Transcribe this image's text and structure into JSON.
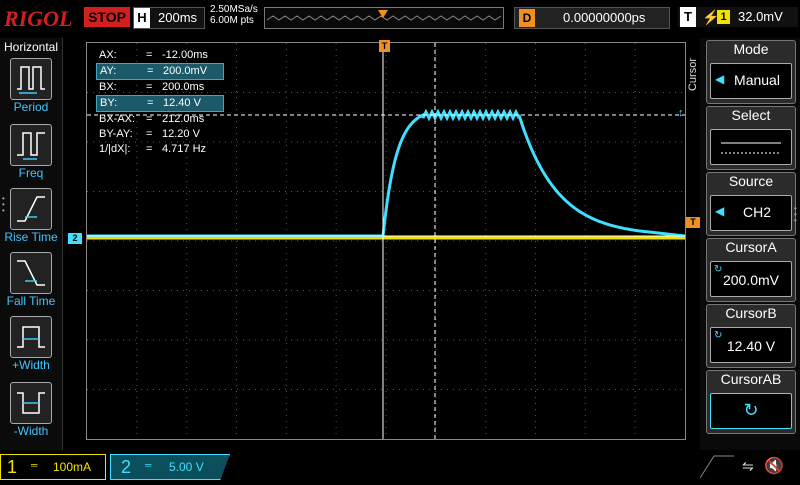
{
  "topbar": {
    "brand": "RIGOL",
    "run_state": "STOP",
    "timebase_tag": "H",
    "timebase": "200ms",
    "sample_rate": "2.50MSa/s",
    "memory_depth": "6.00M pts",
    "delay_tag": "D",
    "delay": "0.00000000ps",
    "trigger_tag": "T",
    "trigger_channel": "1",
    "trigger_level": "32.0mV"
  },
  "left_panel": {
    "title": "Horizontal",
    "buttons": [
      {
        "label": "Period",
        "icon": "period-icon"
      },
      {
        "label": "Freq",
        "icon": "freq-icon"
      },
      {
        "label": "Rise Time",
        "icon": "rise-time-icon"
      },
      {
        "label": "Fall Time",
        "icon": "fall-time-icon"
      },
      {
        "label": "+Width",
        "icon": "pos-width-icon"
      },
      {
        "label": "-Width",
        "icon": "neg-width-icon"
      }
    ]
  },
  "cursor_table": [
    {
      "key": "AX:",
      "value": "-12.00ms",
      "highlight": false
    },
    {
      "key": "AY:",
      "value": "200.0mV",
      "highlight": true
    },
    {
      "key": "BX:",
      "value": "200.0ms",
      "highlight": false
    },
    {
      "key": "BY:",
      "value": "12.40 V",
      "highlight": true
    },
    {
      "key": "BX-AX:",
      "value": "212.0ms",
      "highlight": false
    },
    {
      "key": "BY-AY:",
      "value": "12.20 V",
      "highlight": false
    },
    {
      "key": "1/|dX|:",
      "value": "4.717 Hz",
      "highlight": false
    }
  ],
  "right_panel": {
    "menu_title": "Cursor",
    "mode_label": "Mode",
    "mode_value": "Manual",
    "select_label": "Select",
    "source_label": "Source",
    "source_value": "CH2",
    "cursor_a_label": "CursorA",
    "cursor_a_value": "200.0mV",
    "cursor_b_label": "CursorB",
    "cursor_b_value": "12.40 V",
    "cursor_ab_label": "CursorAB"
  },
  "markers": {
    "ch2_ground": "2",
    "trigger_pos": "T"
  },
  "bottombar": {
    "ch1_num": "1",
    "ch1_coupling": "DC",
    "ch1_scale": "100mA",
    "ch2_num": "2",
    "ch2_coupling": "DC",
    "ch2_scale": "5.00 V"
  },
  "colors": {
    "ch1": "#f2e200",
    "ch2": "#3fe0ff",
    "trigger": "#f0901e",
    "stop": "#d41f1f"
  }
}
